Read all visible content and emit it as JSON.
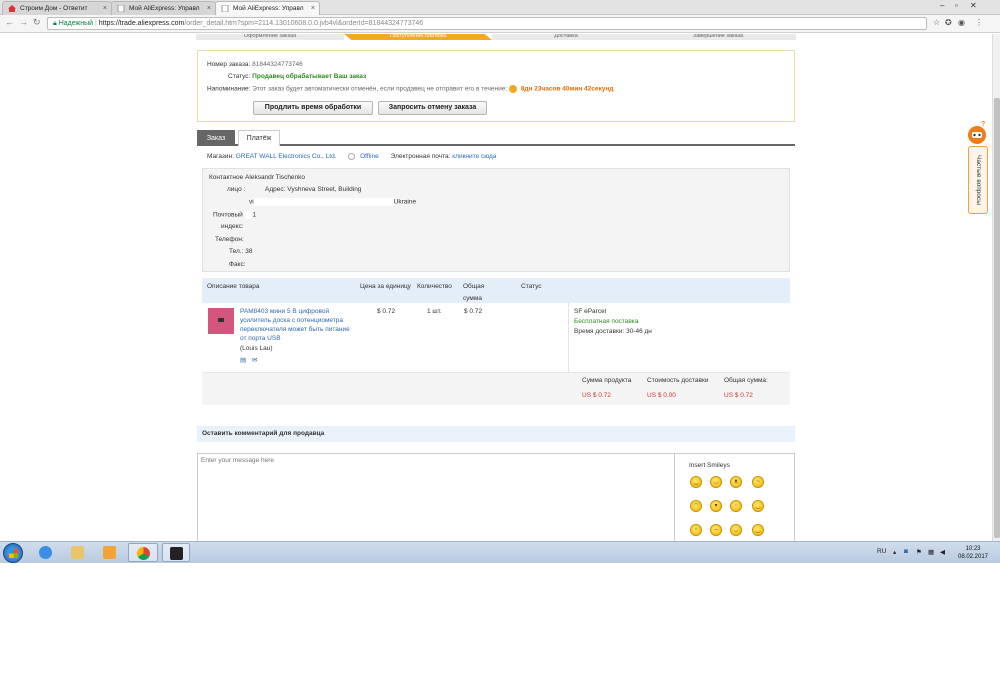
{
  "browser": {
    "tabs": [
      {
        "label": "Строим Дом - Ответит",
        "active": false
      },
      {
        "label": "Мой AliExpress: Управл",
        "active": false
      },
      {
        "label": "Мой AliExpress: Управл",
        "active": true
      }
    ],
    "secure_label": "Надежный",
    "url_host": "https://trade.aliexpress.com",
    "url_rest": "/order_detail.htm?spm=2114.13010608.0.0.jvb4vl&orderId=81844324773746"
  },
  "progress_steps": [
    "Оформление заказа",
    "Поступление платежа",
    "Доставка",
    "Завершение заказа"
  ],
  "order": {
    "number_label": "Номер заказа:",
    "number_value": "81844324773746",
    "status_label": "Статус:",
    "status_value": "Продавец обрабатывает Ваш заказ",
    "reminder_label": "Напоминание:",
    "reminder_text": "Этот заказ будет автоматически отменён, если продавец не отправит его в течение:",
    "reminder_time": "8дн 23часов 40мин 42секунд",
    "btn_extend": "Продлить время обработки",
    "btn_cancel": "Запросить отмену заказа"
  },
  "detail_tabs": [
    "Заказ",
    "Платёж"
  ],
  "store": {
    "label": "Магазин:",
    "name": "GREAT WALL Electronics Co., Ltd.",
    "status": "Offline",
    "email_label": "Электронная почта:",
    "email_link": "кликните сюда"
  },
  "contact": {
    "person_label_1": "Контактное",
    "person_label_2": "лицо :",
    "person_value": "Aleksandr Tischenko",
    "address_label": "Адрес:",
    "address_value": "Vyshneva Street, Building",
    "address_line2_a": "vi",
    "address_line2_b": "Ukraine",
    "postal_label_1": "Почтовый",
    "postal_label_2": "индекс:",
    "postal_value": "1",
    "phone_label": "Телефон:",
    "tel_label": "Тел.:",
    "tel_value": "38",
    "fax_label": "Факс:"
  },
  "table": {
    "headers": [
      "Описание товара",
      "Цена за единицу",
      "Количество",
      "Общая сумма",
      "Статус"
    ],
    "product": {
      "title_lines": [
        "PAM8403 мини 5 В цифровой",
        "усилитель доска с потенциометра",
        "переключателя может быть питание",
        "от порта USB"
      ],
      "seller": "(Louis Lau)",
      "price": "$ 0.72",
      "qty": "1 шт.",
      "total": "$ 0.72",
      "shipping_method": "SF eParcel",
      "shipping_free": "Бесплатная поставка",
      "delivery_time": "Время доставки: 30-46 дн"
    },
    "summary": {
      "product_sum_label": "Сумма продукта",
      "product_sum": "US $ 0.72",
      "shipping_cost_label": "Стоимость доставки",
      "shipping_cost": "US $ 0.00",
      "total_label": "Общая сумма:",
      "total": "US $ 0.72"
    }
  },
  "comment": {
    "heading": "Оставить комментарий для продавца",
    "placeholder": "Enter your message here",
    "smileys_label": "Insert Smileys"
  },
  "help_widget": {
    "label": "Частые вопросы"
  },
  "taskbar": {
    "lang": "RU",
    "time": "10:23",
    "date": "08.02.2017"
  }
}
